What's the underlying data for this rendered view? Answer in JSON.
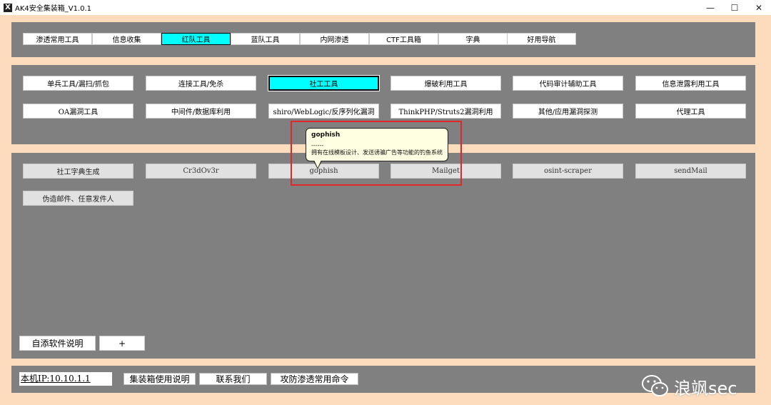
{
  "window": {
    "title": "AK4安全集装箱_V1.0.1",
    "icon_glyph": "X",
    "controls": {
      "minimize": "—",
      "maximize": "☐",
      "close": "✕"
    }
  },
  "tabs": [
    {
      "label": "渗透常用工具",
      "active": false
    },
    {
      "label": "信息收集",
      "active": false
    },
    {
      "label": "红队工具",
      "active": true
    },
    {
      "label": "蓝队工具",
      "active": false
    },
    {
      "label": "内网渗透",
      "active": false
    },
    {
      "label": "CTF工具箱",
      "active": false
    },
    {
      "label": "字典",
      "active": false
    },
    {
      "label": "好用导航",
      "active": false
    }
  ],
  "categories": [
    {
      "label": "单兵工具/漏扫/抓包"
    },
    {
      "label": "连接工具/免杀"
    },
    {
      "label": "社工工具",
      "active": true
    },
    {
      "label": "爆破利用工具"
    },
    {
      "label": "代码审计辅助工具"
    },
    {
      "label": "信息泄露利用工具"
    },
    {
      "label": "OA漏洞工具"
    },
    {
      "label": "中间件/数据库利用"
    },
    {
      "label": "shiro/WebLogic/反序列化漏洞"
    },
    {
      "label": "ThinkPHP/Struts2漏洞利用"
    },
    {
      "label": "其他/应用漏洞探测"
    },
    {
      "label": "代理工具"
    }
  ],
  "tools": [
    {
      "label": "社工字典生成"
    },
    {
      "label": "Cr3dOv3r"
    },
    {
      "label": "gophish"
    },
    {
      "label": "Mailget"
    },
    {
      "label": "osint-scraper"
    },
    {
      "label": "sendMail"
    },
    {
      "label": "伪造邮件、任意发件人"
    }
  ],
  "tooltip": {
    "title": "gophish",
    "separator": "------",
    "description": "拥有在线模板设计、发送诱骗广告等功能的钓鱼系统"
  },
  "self_add": {
    "explain_label": "自添软件说明",
    "add_label": "+"
  },
  "footer": {
    "ip_label": "本机IP:10.10.1.1",
    "buttons": [
      "集装箱使用说明",
      "联系我们",
      "攻防渗透常用命令"
    ]
  },
  "watermark": {
    "text": "浪飒sec"
  },
  "colors": {
    "frame": "#fddcbd",
    "panel": "#808080",
    "active": "#00ffff",
    "tooltip_bg": "#ffffe1",
    "highlight": "#e0282a"
  }
}
